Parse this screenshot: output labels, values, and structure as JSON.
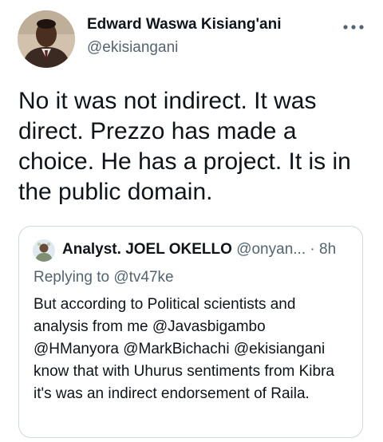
{
  "tweet": {
    "author_name": "Edward Waswa Kisiang'ani",
    "author_handle": "@ekisiangani",
    "more_icon": "ellipsis-horizontal-icon",
    "text": "No it was not indirect. It was direct. Prezzo has made a choice. He has a project. It is in the public domain."
  },
  "quoted_tweet": {
    "author_name": "Analyst. JOEL OKELLO",
    "author_handle": "@onyan...",
    "separator": "·",
    "time": "8h",
    "replying_to": "Replying to @tv47ke",
    "text": "But according to Political scientists and analysis from me @Javasbigambo @HManyora @MarkBichachi @ekisiangani know that with Uhurus sentiments from Kibra it's was an indirect endorsement of Raila."
  },
  "colors": {
    "primary_text": "#0f1419",
    "secondary_text": "#536471",
    "border": "#cfd9de",
    "background": "#ffffff"
  }
}
